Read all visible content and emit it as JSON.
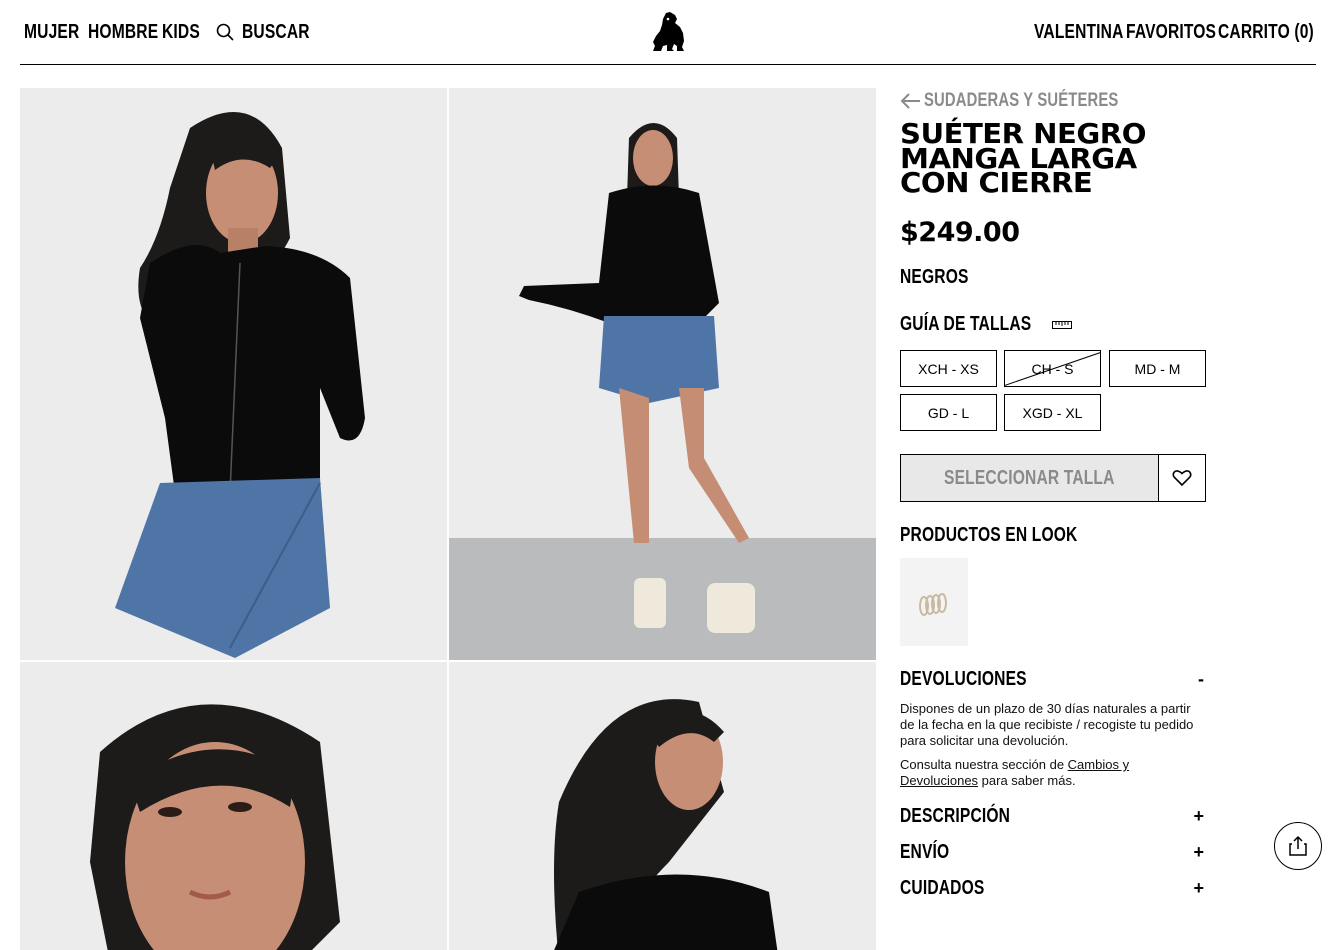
{
  "header": {
    "nav_left": [
      "MUJER",
      "HOMBRE",
      "KIDS"
    ],
    "search_label": "BUSCAR",
    "nav_right": [
      "VALENTINA",
      "FAVORITOS",
      "CARRITO (0)"
    ],
    "logo_icon": "bulldog-logo-icon"
  },
  "product": {
    "breadcrumb": "SUDADERAS Y SUÉTERES",
    "title_lines": [
      "SUÉTER NEGRO",
      "MANGA LARGA",
      "CON CIERRE"
    ],
    "price": "$249.00",
    "color": "NEGROS",
    "size_guide_label": "GUÍA DE TALLAS",
    "sizes": [
      {
        "label": "XCH - XS",
        "available": true
      },
      {
        "label": "CH - S",
        "available": false
      },
      {
        "label": "MD - M",
        "available": true
      },
      {
        "label": "GD - L",
        "available": true
      },
      {
        "label": "XGD - XL",
        "available": true
      }
    ],
    "select_size_label": "SELECCIONAR TALLA",
    "look_title": "PRODUCTOS EN LOOK"
  },
  "accordion": {
    "returns": {
      "title": "DEVOLUCIONES",
      "sign": "-",
      "text1": "Dispones de un plazo de 30 días naturales a partir de la fecha en la que recibiste / recogiste tu pedido para solicitar una devolución.",
      "text2_prefix": "Consulta nuestra sección de ",
      "text2_link": "Cambios y Devoluciones",
      "text2_suffix": " para saber más."
    },
    "description": {
      "title": "DESCRIPCIÓN",
      "sign": "+"
    },
    "shipping": {
      "title": "ENVÍO",
      "sign": "+"
    },
    "care": {
      "title": "CUIDADOS",
      "sign": "+"
    }
  },
  "colors": {
    "text": "#000000",
    "muted": "#8a8a8a",
    "button_disabled_bg": "#e8e8e8",
    "photo_bg": "#ededed",
    "denim": "#4f74a6"
  }
}
